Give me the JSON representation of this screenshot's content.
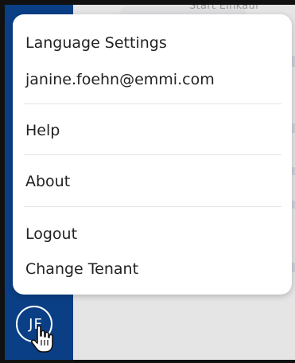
{
  "background": {
    "header_fragment": "Start Einkauf"
  },
  "menu": {
    "items": [
      {
        "label": "Language Settings"
      },
      {
        "label": "janine.foehn@emmi.com"
      },
      {
        "label": "Help"
      },
      {
        "label": "About"
      },
      {
        "label": "Logout"
      },
      {
        "label": "Change Tenant"
      }
    ]
  },
  "user": {
    "initials": "JF"
  },
  "colors": {
    "nav_blue": "#0a3f86",
    "menu_bg": "#ffffff",
    "divider": "#e4e4e4"
  },
  "icons": {
    "cursor": "hand-pointer-icon"
  }
}
